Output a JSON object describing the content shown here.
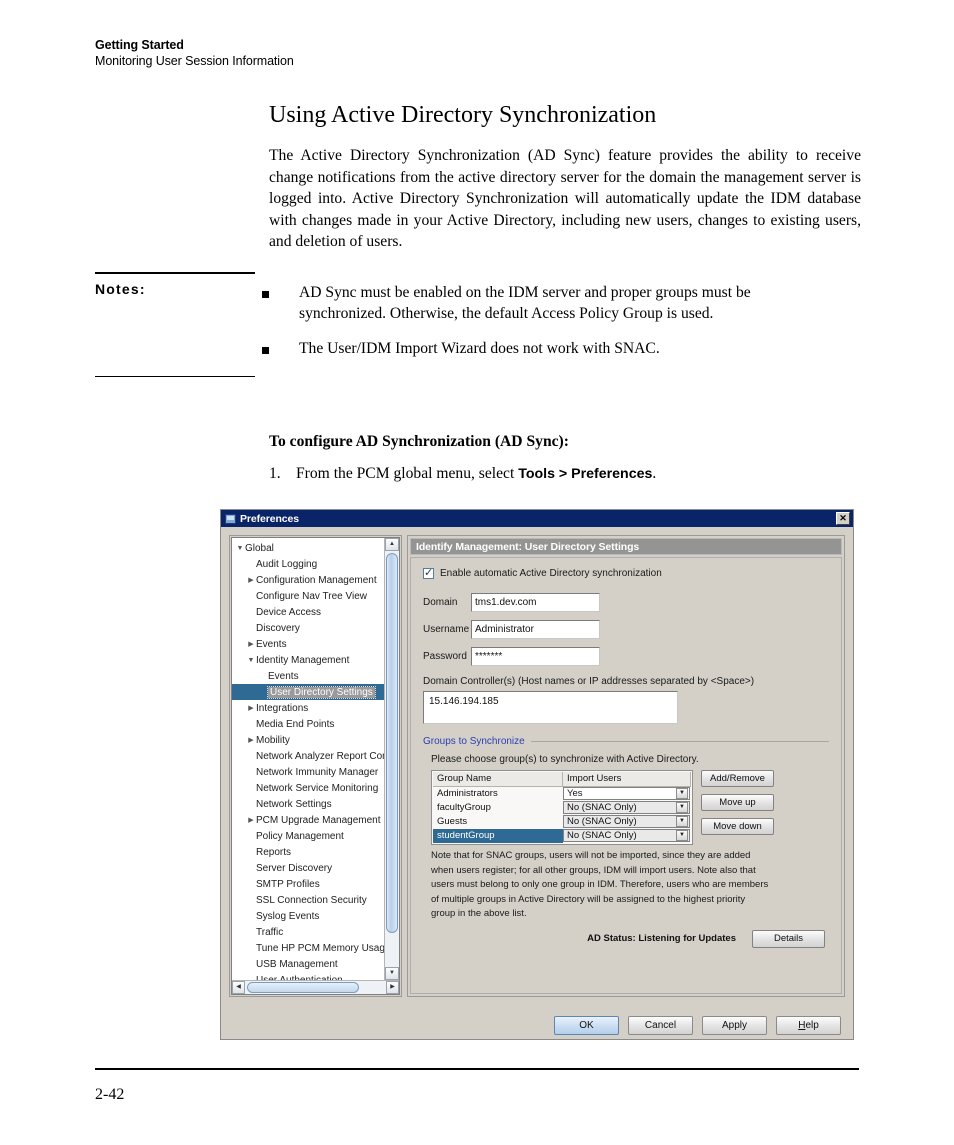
{
  "page": {
    "running_head_title": "Getting Started",
    "running_head_subtitle": "Monitoring User Session Information",
    "page_number": "2-42"
  },
  "section": {
    "heading": "Using Active Directory Synchronization",
    "intro_paragraph": "The Active Directory Synchronization (AD Sync) feature provides the ability to receive change notifications from the active directory server for the domain the management server is logged into. Active Directory Synchronization will automatically update the IDM database with changes made in your Active Directory, including new users, changes to existing users, and deletion of users."
  },
  "notes": {
    "label": "Notes:",
    "items": [
      "AD Sync must be enabled on the IDM server and proper groups must be synchronized. Otherwise, the default Access Policy Group is used.",
      "The User/IDM Import Wizard does not work with SNAC."
    ]
  },
  "procedure": {
    "title": "To configure AD Synchronization (AD Sync):",
    "step_number": "1.",
    "step_text_before": "From the PCM global menu, select ",
    "step_text_bold": "Tools > Preferences",
    "step_text_after": "."
  },
  "dialog": {
    "title": "Preferences",
    "close_label": "✕",
    "panel_header": "Identify Management: User Directory Settings",
    "tree": [
      {
        "label": "Global",
        "depth": 0,
        "arrow": "▼",
        "selected": false
      },
      {
        "label": "Audit Logging",
        "depth": 1,
        "arrow": "",
        "selected": false
      },
      {
        "label": "Configuration Management",
        "depth": 1,
        "arrow": "▶",
        "selected": false
      },
      {
        "label": "Configure Nav Tree View",
        "depth": 1,
        "arrow": "",
        "selected": false
      },
      {
        "label": "Device Access",
        "depth": 1,
        "arrow": "",
        "selected": false
      },
      {
        "label": "Discovery",
        "depth": 1,
        "arrow": "",
        "selected": false
      },
      {
        "label": "Events",
        "depth": 1,
        "arrow": "▶",
        "selected": false
      },
      {
        "label": "Identity Management",
        "depth": 1,
        "arrow": "▼",
        "selected": false
      },
      {
        "label": "Events",
        "depth": 2,
        "arrow": "",
        "selected": false
      },
      {
        "label": "User Directory Settings",
        "depth": 2,
        "arrow": "",
        "selected": true
      },
      {
        "label": "Integrations",
        "depth": 1,
        "arrow": "▶",
        "selected": false
      },
      {
        "label": "Media End Points",
        "depth": 1,
        "arrow": "",
        "selected": false
      },
      {
        "label": "Mobility",
        "depth": 1,
        "arrow": "▶",
        "selected": false
      },
      {
        "label": "Network Analyzer Report Config",
        "depth": 1,
        "arrow": "",
        "selected": false
      },
      {
        "label": "Network Immunity Manager",
        "depth": 1,
        "arrow": "",
        "selected": false
      },
      {
        "label": "Network Service Monitoring",
        "depth": 1,
        "arrow": "",
        "selected": false
      },
      {
        "label": "Network Settings",
        "depth": 1,
        "arrow": "",
        "selected": false
      },
      {
        "label": "PCM Upgrade Management",
        "depth": 1,
        "arrow": "▶",
        "selected": false
      },
      {
        "label": "Policy Management",
        "depth": 1,
        "arrow": "",
        "selected": false
      },
      {
        "label": "Reports",
        "depth": 1,
        "arrow": "",
        "selected": false
      },
      {
        "label": "Server Discovery",
        "depth": 1,
        "arrow": "",
        "selected": false
      },
      {
        "label": "SMTP Profiles",
        "depth": 1,
        "arrow": "",
        "selected": false
      },
      {
        "label": "SSL Connection Security",
        "depth": 1,
        "arrow": "",
        "selected": false
      },
      {
        "label": "Syslog Events",
        "depth": 1,
        "arrow": "",
        "selected": false
      },
      {
        "label": "Traffic",
        "depth": 1,
        "arrow": "",
        "selected": false
      },
      {
        "label": "Tune HP PCM Memory Usage",
        "depth": 1,
        "arrow": "",
        "selected": false
      },
      {
        "label": "USB Management",
        "depth": 1,
        "arrow": "",
        "selected": false
      },
      {
        "label": "User Authentication",
        "depth": 1,
        "arrow": "",
        "selected": false
      }
    ],
    "scroll": {
      "up_arrow": "▲",
      "down_arrow": "▼",
      "left_arrow": "◀",
      "right_arrow": "▶"
    },
    "form": {
      "enable_checkbox_label": "Enable automatic Active Directory synchronization",
      "enable_checked": true,
      "domain_label": "Domain",
      "domain_value": "tms1.dev.com",
      "username_label": "Username",
      "username_value": "Administrator",
      "password_label": "Password",
      "password_value": "*******",
      "dc_label": "Domain Controller(s) (Host names or IP addresses separated by <Space>)",
      "dc_value": "15.146.194.185"
    },
    "groups": {
      "legend": "Groups to Synchronize",
      "hint": "Please choose group(s) to synchronize with Active Directory.",
      "columns": [
        "Group Name",
        "Import Users"
      ],
      "rows": [
        {
          "name": "Administrators",
          "import": "Yes",
          "selected": false
        },
        {
          "name": "facultyGroup",
          "import": "No (SNAC Only)",
          "selected": false
        },
        {
          "name": "Guests",
          "import": "No (SNAC Only)",
          "selected": false
        },
        {
          "name": "studentGroup",
          "import": "No (SNAC Only)",
          "selected": true
        }
      ],
      "buttons": [
        "Add/Remove",
        "Move up",
        "Move down"
      ],
      "combo_arrow": "▼",
      "note": "Note that for SNAC groups, users will not be imported, since they are added when users register; for all other groups, IDM will import users. Note also that users must belong to only one group in IDM. Therefore, users who are members of multiple groups in Active Directory will be assigned to the highest priority group in the above list.",
      "ad_status": "AD Status: Listening for Updates",
      "details_button": "Details"
    },
    "footer_buttons": [
      {
        "label": "OK",
        "default": true,
        "mnemonic": ""
      },
      {
        "label": "Cancel",
        "default": false,
        "mnemonic": ""
      },
      {
        "label": "Apply",
        "default": false,
        "mnemonic": ""
      },
      {
        "label": "Help",
        "default": false,
        "mnemonic": "H"
      }
    ]
  },
  "colors": {
    "titlebar": "#0a246a",
    "dialog_face": "#d4d0c8",
    "selection": "#2f6a94",
    "legend_text": "#2b3fb0",
    "panel_header": "#949494"
  }
}
